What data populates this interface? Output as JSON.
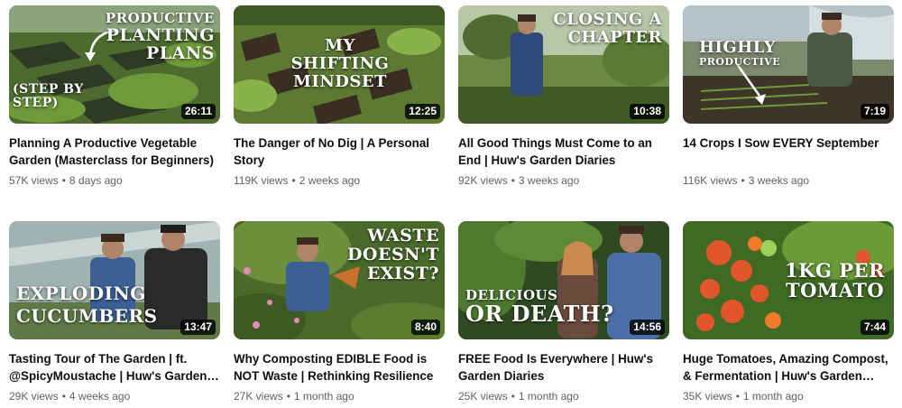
{
  "videos": [
    {
      "title_line1": "Planning A Productive Vegetable",
      "title_line2": "Garden (Masterclass for Beginners)",
      "views": "57K views",
      "age": "8 days ago",
      "duration": "26:11",
      "overlay_1": "PRODUCTIVE",
      "overlay_2": "PLANTING",
      "overlay_3": "PLANS",
      "overlay_4": "(STEP BY",
      "overlay_5": "STEP)"
    },
    {
      "title_line1": "The Danger of No Dig | A Personal",
      "title_line2": "Story",
      "views": "119K views",
      "age": "2 weeks ago",
      "duration": "12:25",
      "overlay_1": "MY",
      "overlay_2": "SHIFTING",
      "overlay_3": "MINDSET"
    },
    {
      "title_line1": "All Good Things Must Come to an",
      "title_line2": "End | Huw's Garden Diaries",
      "views": "92K views",
      "age": "3 weeks ago",
      "duration": "10:38",
      "overlay_1": "CLOSING A",
      "overlay_2": "CHAPTER"
    },
    {
      "title_line1": "14 Crops I Sow EVERY September",
      "title_line2": "",
      "views": "116K views",
      "age": "3 weeks ago",
      "duration": "7:19",
      "overlay_1": "HIGHLY",
      "overlay_2": "PRODUCTIVE"
    },
    {
      "title_line1": "Tasting Tour of The Garden | ft.",
      "title_line2": "@SpicyMoustache | Huw's Garden…",
      "views": "29K views",
      "age": "4 weeks ago",
      "duration": "13:47",
      "overlay_1": "EXPLODING",
      "overlay_2": "CUCUMBERS"
    },
    {
      "title_line1": "Why Composting EDIBLE Food is",
      "title_line2": "NOT Waste | Rethinking Resilience",
      "views": "27K views",
      "age": "1 month ago",
      "duration": "8:40",
      "overlay_1": "WASTE",
      "overlay_2": "DOESN'T",
      "overlay_3": "EXIST?"
    },
    {
      "title_line1": "FREE Food Is Everywhere | Huw's",
      "title_line2": "Garden Diaries",
      "views": "25K views",
      "age": "1 month ago",
      "duration": "14:56",
      "overlay_1": "DELICIOUS",
      "overlay_2": "OR DEATH?"
    },
    {
      "title_line1": "Huge Tomatoes, Amazing Compost,",
      "title_line2": "& Fermentation | Huw's Garden…",
      "views": "35K views",
      "age": "1 month ago",
      "duration": "7:44",
      "overlay_1": "1KG PER",
      "overlay_2": "TOMATO"
    }
  ],
  "separator": "•"
}
